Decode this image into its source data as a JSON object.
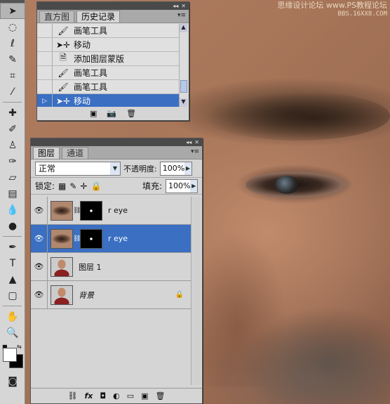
{
  "watermark": {
    "line1": "思缘设计论坛  www.PS教程论坛",
    "line2": "BBS.16XX8.COM"
  },
  "toolbar": {
    "tools": [
      "move-tool",
      "marquee-tool",
      "lasso-tool",
      "quick-select-tool",
      "crop-tool",
      "eyedropper-tool",
      "healing-brush-tool",
      "brush-tool",
      "clone-stamp-tool",
      "history-brush-tool",
      "eraser-tool",
      "gradient-tool",
      "blur-tool",
      "dodge-tool",
      "pen-tool",
      "type-tool",
      "path-select-tool",
      "shape-tool",
      "hand-tool",
      "zoom-tool"
    ],
    "colors": {
      "foreground": "#ffffff",
      "background": "#000000"
    }
  },
  "history": {
    "tabs": [
      "直方图",
      "历史记录"
    ],
    "active_tab": "历史记录",
    "items": [
      {
        "label": "画笔工具",
        "icon": "brush-icon",
        "selected": false
      },
      {
        "label": "移动",
        "icon": "move-icon",
        "selected": false
      },
      {
        "label": "添加图层蒙版",
        "icon": "document-icon",
        "selected": false
      },
      {
        "label": "画笔工具",
        "icon": "brush-icon",
        "selected": false
      },
      {
        "label": "画笔工具",
        "icon": "brush-icon",
        "selected": false
      },
      {
        "label": "移动",
        "icon": "move-icon",
        "selected": true
      }
    ]
  },
  "layers": {
    "tabs": [
      "图层",
      "通道"
    ],
    "active_tab": "图层",
    "blend_mode": "正常",
    "opacity_label": "不透明度:",
    "opacity": "100%",
    "lock_label": "锁定:",
    "fill_label": "填充:",
    "fill": "100%",
    "items": [
      {
        "name": "r eye",
        "type": "masked",
        "selected": false
      },
      {
        "name": "r eye",
        "type": "masked",
        "selected": true
      },
      {
        "name": "图层 1",
        "type": "portrait",
        "selected": false
      },
      {
        "name": "背景",
        "type": "background",
        "selected": false,
        "locked": true
      }
    ]
  },
  "accent_color": "#3a6fc2"
}
